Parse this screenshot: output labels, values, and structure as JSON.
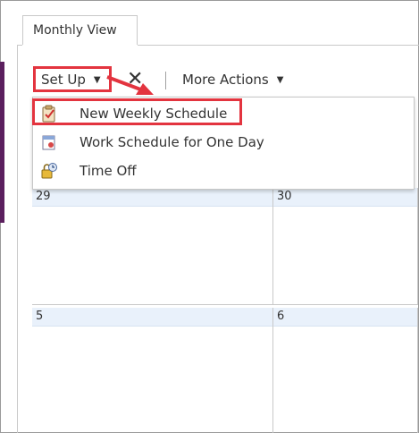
{
  "tabs": [
    {
      "label": "Monthly View"
    }
  ],
  "toolbar": {
    "setup_label": "Set Up",
    "more_actions_label": "More Actions"
  },
  "setup_menu": {
    "items": [
      {
        "label": "New Weekly Schedule",
        "icon": "clipboard-check-icon"
      },
      {
        "label": "Work Schedule for One Day",
        "icon": "calendar-day-icon"
      },
      {
        "label": "Time Off",
        "icon": "lock-clock-icon"
      }
    ]
  },
  "calendar": {
    "days": [
      {
        "label": "29"
      },
      {
        "label": "30"
      },
      {
        "label": "5"
      },
      {
        "label": "6"
      }
    ]
  },
  "colors": {
    "highlight": "#e3343f",
    "day_header": "#e9f1fb",
    "accent_strip": "#5b1f5e"
  }
}
